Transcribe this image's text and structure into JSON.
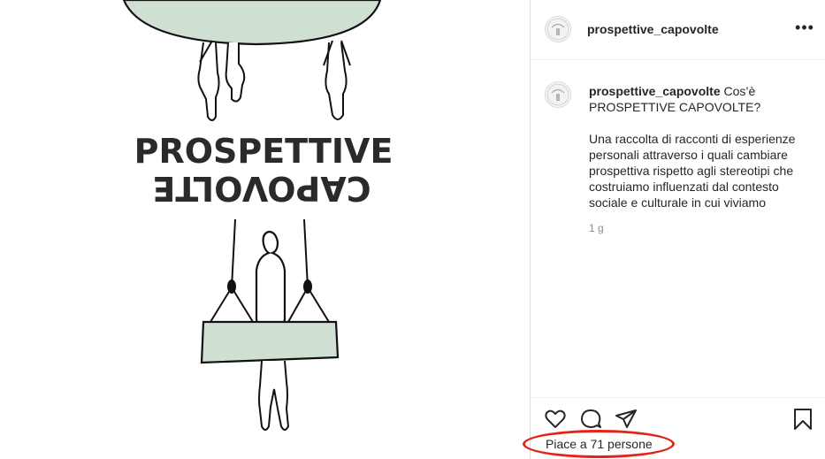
{
  "post": {
    "image_text": {
      "line1": "PROSPETTIVE",
      "line2": "CAPOVOLTE"
    }
  },
  "header": {
    "username": "prospettive_capovolte",
    "more_label": "•••"
  },
  "caption": {
    "username": "prospettive_capovolte",
    "title": "Cos’è PROSPETTIVE CAPOVOLTE?",
    "body": "Una raccolta di racconti di esperienze personali attraverso i quali cambiare prospettiva rispetto agli stereotipi che costruiamo influenzati dal contesto sociale e culturale in cui viviamo",
    "time": "1 g"
  },
  "actions": {
    "icons": [
      "heart-icon",
      "comment-icon",
      "share-icon",
      "bookmark-icon"
    ],
    "likes": "Piace a 71 persone"
  },
  "colors": {
    "illustration_fill": "#cfe0d2",
    "annotation": "#e3241b"
  }
}
